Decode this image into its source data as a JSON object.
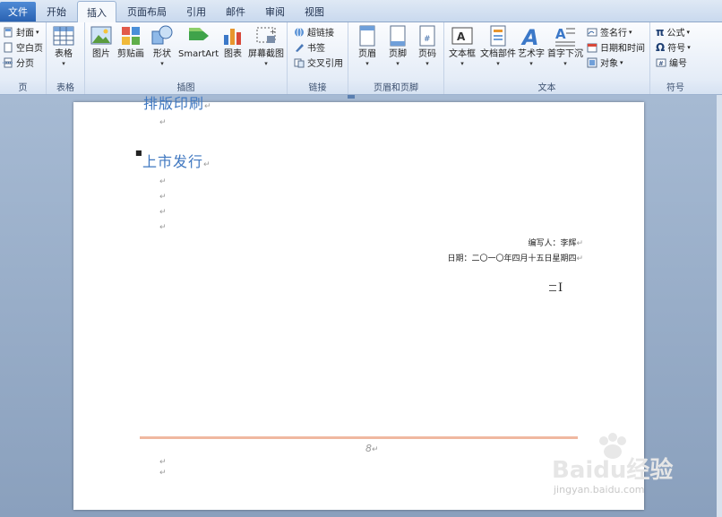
{
  "tabs": {
    "file": "文件",
    "items": [
      "开始",
      "插入",
      "页面布局",
      "引用",
      "邮件",
      "审阅",
      "视图"
    ],
    "active_index": 1
  },
  "ribbon": {
    "pages_group": {
      "label": "页",
      "cover": "封面",
      "blank": "空白页",
      "break": "分页"
    },
    "tables_group": {
      "label": "表格",
      "table": "表格"
    },
    "illustrations_group": {
      "label": "插图",
      "picture": "图片",
      "clipart": "剪贴画",
      "shapes": "形状",
      "smartart": "SmartArt",
      "chart": "图表",
      "screenshot": "屏幕截图"
    },
    "links_group": {
      "label": "链接",
      "hyperlink": "超链接",
      "bookmark": "书签",
      "crossref": "交叉引用"
    },
    "header_footer_group": {
      "label": "页眉和页脚",
      "header": "页眉",
      "footer": "页脚",
      "page_number": "页码"
    },
    "text_group": {
      "label": "文本",
      "textbox": "文本框",
      "quickparts": "文档部件",
      "wordart": "艺术字",
      "dropcap": "首字下沉",
      "signature": "签名行",
      "datetime": "日期和时间",
      "object": "对象"
    },
    "symbols_group": {
      "label": "符号",
      "equation": "公式",
      "symbol": "符号",
      "numbering": "编号"
    }
  },
  "document": {
    "heading_top": "排版印刷",
    "heading_main": "上市发行",
    "author_line": "编写人：李辉",
    "date_line": "日期：二〇一〇年四月十五日星期四",
    "paragraph_mark": "↵",
    "page_number": "8"
  },
  "watermark": {
    "brand": "Baidu经验",
    "url": "jingyan.baidu.com"
  }
}
